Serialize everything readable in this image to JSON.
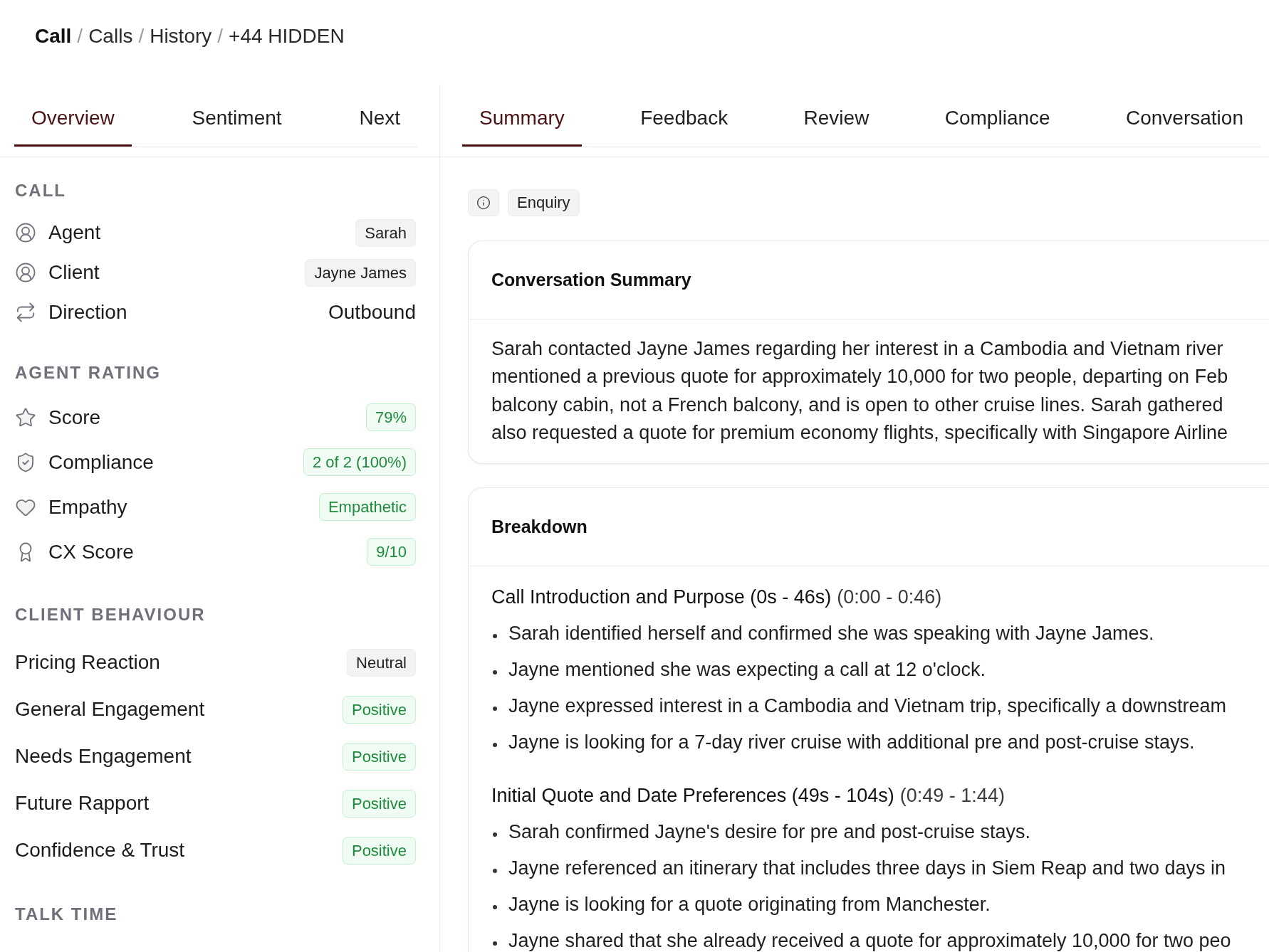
{
  "breadcrumb": [
    {
      "kind": "title",
      "label": "Call"
    },
    {
      "kind": "separator",
      "label": "/"
    },
    {
      "kind": "link",
      "label": "Calls"
    },
    {
      "kind": "separator",
      "label": "/"
    },
    {
      "kind": "link",
      "label": "History"
    },
    {
      "kind": "separator",
      "label": "/"
    },
    {
      "kind": "current",
      "label": "+44 HIDDEN"
    }
  ],
  "left_tabs": [
    {
      "label": "Overview",
      "selected": true
    },
    {
      "label": "Sentiment",
      "selected": false
    },
    {
      "label": "Next",
      "selected": false
    }
  ],
  "sections": [
    {
      "title": "CALL",
      "rows": [
        {
          "label": "Agent",
          "value": "Sarah",
          "kind": "neutral"
        },
        {
          "label": "Client",
          "value": "Jayne James",
          "kind": "neutral"
        },
        {
          "label": "Direction",
          "value": "Outbound",
          "kind": "plain"
        }
      ]
    },
    {
      "title": "AGENT RATING",
      "rows": [
        {
          "label": "Score",
          "value": "79%",
          "kind": "positive"
        },
        {
          "label": "Compliance",
          "value": "2 of 2 (100%)",
          "kind": "positive"
        },
        {
          "label": "Empathy",
          "value": "Empathetic",
          "kind": "positive"
        },
        {
          "label": "CX Score",
          "value": "9/10",
          "kind": "positive"
        }
      ]
    },
    {
      "title": "CLIENT BEHAVIOUR",
      "rows": [
        {
          "label": "Pricing Reaction",
          "value": "Neutral",
          "kind": "neutral"
        },
        {
          "label": "General Engagement",
          "value": "Positive",
          "kind": "positive"
        },
        {
          "label": "Needs Engagement",
          "value": "Positive",
          "kind": "positive"
        },
        {
          "label": "Future Rapport",
          "value": "Positive",
          "kind": "positive"
        },
        {
          "label": "Confidence & Trust",
          "value": "Positive",
          "kind": "positive"
        }
      ]
    },
    {
      "title": "TALK TIME"
    }
  ],
  "right_tabs": [
    {
      "label": "Summary",
      "selected": true
    },
    {
      "label": "Feedback",
      "selected": false
    },
    {
      "label": "Review",
      "selected": false
    },
    {
      "label": "Compliance",
      "selected": false
    },
    {
      "label": "Conversation",
      "selected": false
    }
  ],
  "category": "Enquiry",
  "summary_card": {
    "title": "Conversation Summary",
    "lines": [
      "Sarah contacted Jayne James regarding her interest in a Cambodia and Vietnam river",
      "mentioned a previous quote for approximately 10,000 for two people, departing on Feb",
      "balcony cabin, not a French balcony, and is open to other cruise lines. Sarah gathered",
      "also requested a quote for premium economy flights, specifically with Singapore Airline"
    ]
  },
  "breakdown_card": {
    "title": "Breakdown",
    "sections": [
      {
        "title": "Call Introduction and Purpose (0s - 46s)",
        "time": "(0:00 - 0:46)",
        "points": [
          "Sarah identified herself and confirmed she was speaking with Jayne James.",
          "Jayne mentioned she was expecting a call at 12 o'clock.",
          "Jayne expressed interest in a Cambodia and Vietnam trip, specifically a downstream",
          "Jayne is looking for a 7-day river cruise with additional pre and post-cruise stays."
        ]
      },
      {
        "title": "Initial Quote and Date Preferences (49s - 104s)",
        "time": "(0:49 - 1:44)",
        "points": [
          "Sarah confirmed Jayne's desire for pre and post-cruise stays.",
          "Jayne referenced an itinerary that includes three days in Siem Reap and two days in",
          "Jayne is looking for a quote originating from Manchester.",
          "Jayne shared that she already received a quote for approximately 10,000 for two peo"
        ]
      }
    ]
  }
}
